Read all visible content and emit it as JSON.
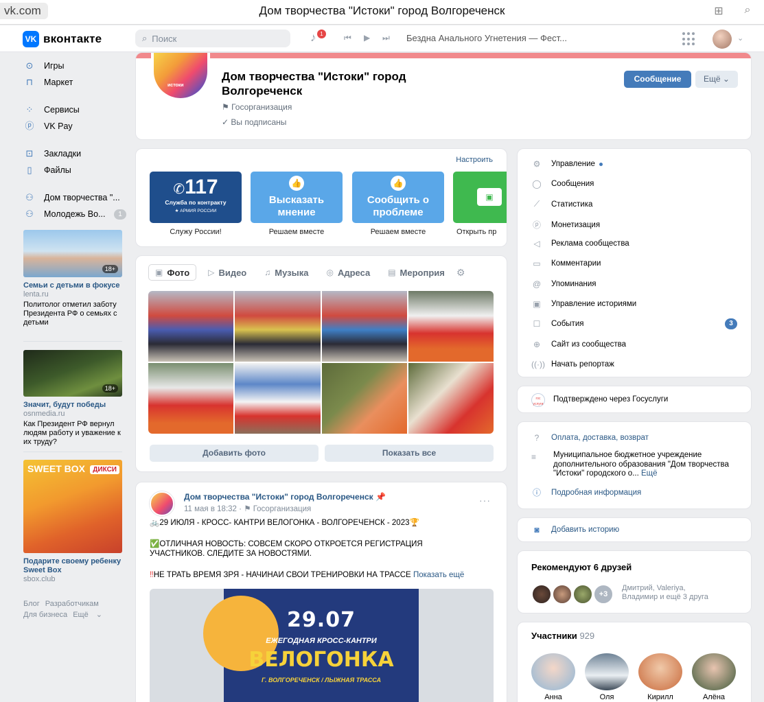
{
  "browser": {
    "url": "vk.com",
    "window_title": "Дом творчества \"Истоки\" город Волгореченск"
  },
  "header": {
    "logo_text": "вконтакте",
    "search_placeholder": "Поиск",
    "notifications_count": "1",
    "now_playing": "Бездна Анального Угнетения — Фест..."
  },
  "leftnav": {
    "items": [
      {
        "label": "Игры",
        "icon": "gamepad-icon"
      },
      {
        "label": "Маркет",
        "icon": "shopping-bag-icon"
      },
      {
        "label": "Сервисы",
        "icon": "grid-icon"
      },
      {
        "label": "VK Pay",
        "icon": "vk-pay-icon"
      },
      {
        "label": "Закладки",
        "icon": "bookmark-icon"
      },
      {
        "label": "Файлы",
        "icon": "file-icon"
      },
      {
        "label": "Дом творчества \"...",
        "icon": "group-icon"
      },
      {
        "label": "Молодежь Во...",
        "icon": "group-icon",
        "count": "1"
      }
    ],
    "ads": [
      {
        "title": "Семьи с детьми в фокусе",
        "source": "lenta.ru",
        "text": "Политолог отметил заботу Президента РФ о семьях с детьми",
        "age": "18+"
      },
      {
        "title": "Значит, будут победы",
        "source": "osnmedia.ru",
        "text": "Как Президент РФ вернул людям работу и уважение к их труду?",
        "age": "18+"
      },
      {
        "title": "Подарите своему ребенку Sweet Box",
        "source": "sbox.club",
        "text": "",
        "brand1": "SWEET BOX",
        "brand2": "ДИКСИ"
      }
    ],
    "footer": {
      "blog": "Блог",
      "developers": "Разработчикам",
      "business": "Для бизнеса",
      "more": "Ещё"
    }
  },
  "community": {
    "name": "Дом творчества \"Истоки\" город Волгореченск",
    "type": "Госорганизация",
    "subscribed": "Вы подписаны",
    "message_button": "Сообщение",
    "more_button": "Ещё",
    "avatar_label": "истоки"
  },
  "widgets": {
    "configure": "Настроить",
    "tiles": [
      {
        "title": "117",
        "subtitle": "Служба по контракту",
        "extra": "АРМИЯ РОССИИ",
        "caption": "Служу России!",
        "color": "#1f4e8c"
      },
      {
        "title": "Высказать мнение",
        "caption": "Решаем вместе",
        "color": "#5aa7e8"
      },
      {
        "title": "Сообщить о проблеме",
        "caption": "Решаем вместе",
        "color": "#5aa7e8"
      },
      {
        "title": "",
        "caption": "Открыть пр",
        "color": "#3fb94f"
      }
    ]
  },
  "media": {
    "tabs": [
      "Фото",
      "Видео",
      "Музыка",
      "Адреса",
      "Мероприя"
    ],
    "add_photo": "Добавить фото",
    "show_all": "Показать все"
  },
  "post": {
    "author": "Дом творчества \"Истоки\" город Волгореченск",
    "date": "11 мая в 18:32",
    "type": "Госорганизация",
    "line1": "29 ИЮЛЯ - КРОСС- КАНТРИ ВЕЛОГОНКА - ВОЛГОРЕЧЕНСК - 2023",
    "line2": "ОТЛИЧНАЯ НОВОСТЬ: СОВСЕМ СКОРО ОТКРОЕТСЯ РЕГИСТРАЦИЯ",
    "line3": "УЧАСТНИКОВ. СЛЕДИТЕ ЗА НОВОСТЯМИ.",
    "line4": "НЕ ТРАТЬ ВРЕМЯ ЗРЯ - НАЧИНАЙ СВОИ ТРЕНИРОВКИ НА ТРАССЕ",
    "show_more": "Показать ещё",
    "poster": {
      "date": "29.07",
      "sub": "ЕЖЕГОДНАЯ КРОСС-КАНТРИ",
      "big": "ВЕЛОГОНКА",
      "town": "Г. ВОЛГОРЕЧЕНСК / ЛЫЖНАЯ ТРАССА"
    }
  },
  "manage_menu": [
    {
      "label": "Управление",
      "icon": "gear-icon"
    },
    {
      "label": "Сообщения",
      "icon": "chat-icon"
    },
    {
      "label": "Статистика",
      "icon": "chart-icon"
    },
    {
      "label": "Монетизация",
      "icon": "ruble-icon"
    },
    {
      "label": "Реклама сообщества",
      "icon": "megaphone-icon"
    },
    {
      "label": "Комментарии",
      "icon": "comment-icon"
    },
    {
      "label": "Упоминания",
      "icon": "at-icon"
    },
    {
      "label": "Управление историями",
      "icon": "stories-icon"
    },
    {
      "label": "События",
      "icon": "event-icon",
      "count": "3"
    },
    {
      "label": "Сайт из сообщества",
      "icon": "globe-icon"
    },
    {
      "label": "Начать репортаж",
      "icon": "broadcast-icon"
    }
  ],
  "gosuslugi": {
    "text": "Подтверждено через Госуслуги",
    "badge": "гос услуги"
  },
  "info": {
    "payment": "Оплата, доставка, возврат",
    "description": "Муниципальное бюджетное учреждение дополнительного образования \"Дом творчества \"Истоки\" городского о...",
    "more": "Ещё",
    "details": "Подробная информация"
  },
  "story": {
    "add": "Добавить историю"
  },
  "friends": {
    "title": "Рекомендуют 6 друзей",
    "extra": "+3",
    "names": "Дмитрий, Valeriya,",
    "names2": "Владимир и ещё 3 друга"
  },
  "members": {
    "title": "Участники",
    "count": "929",
    "list": [
      "Анна",
      "Оля",
      "Кирилл",
      "Алёна"
    ]
  }
}
